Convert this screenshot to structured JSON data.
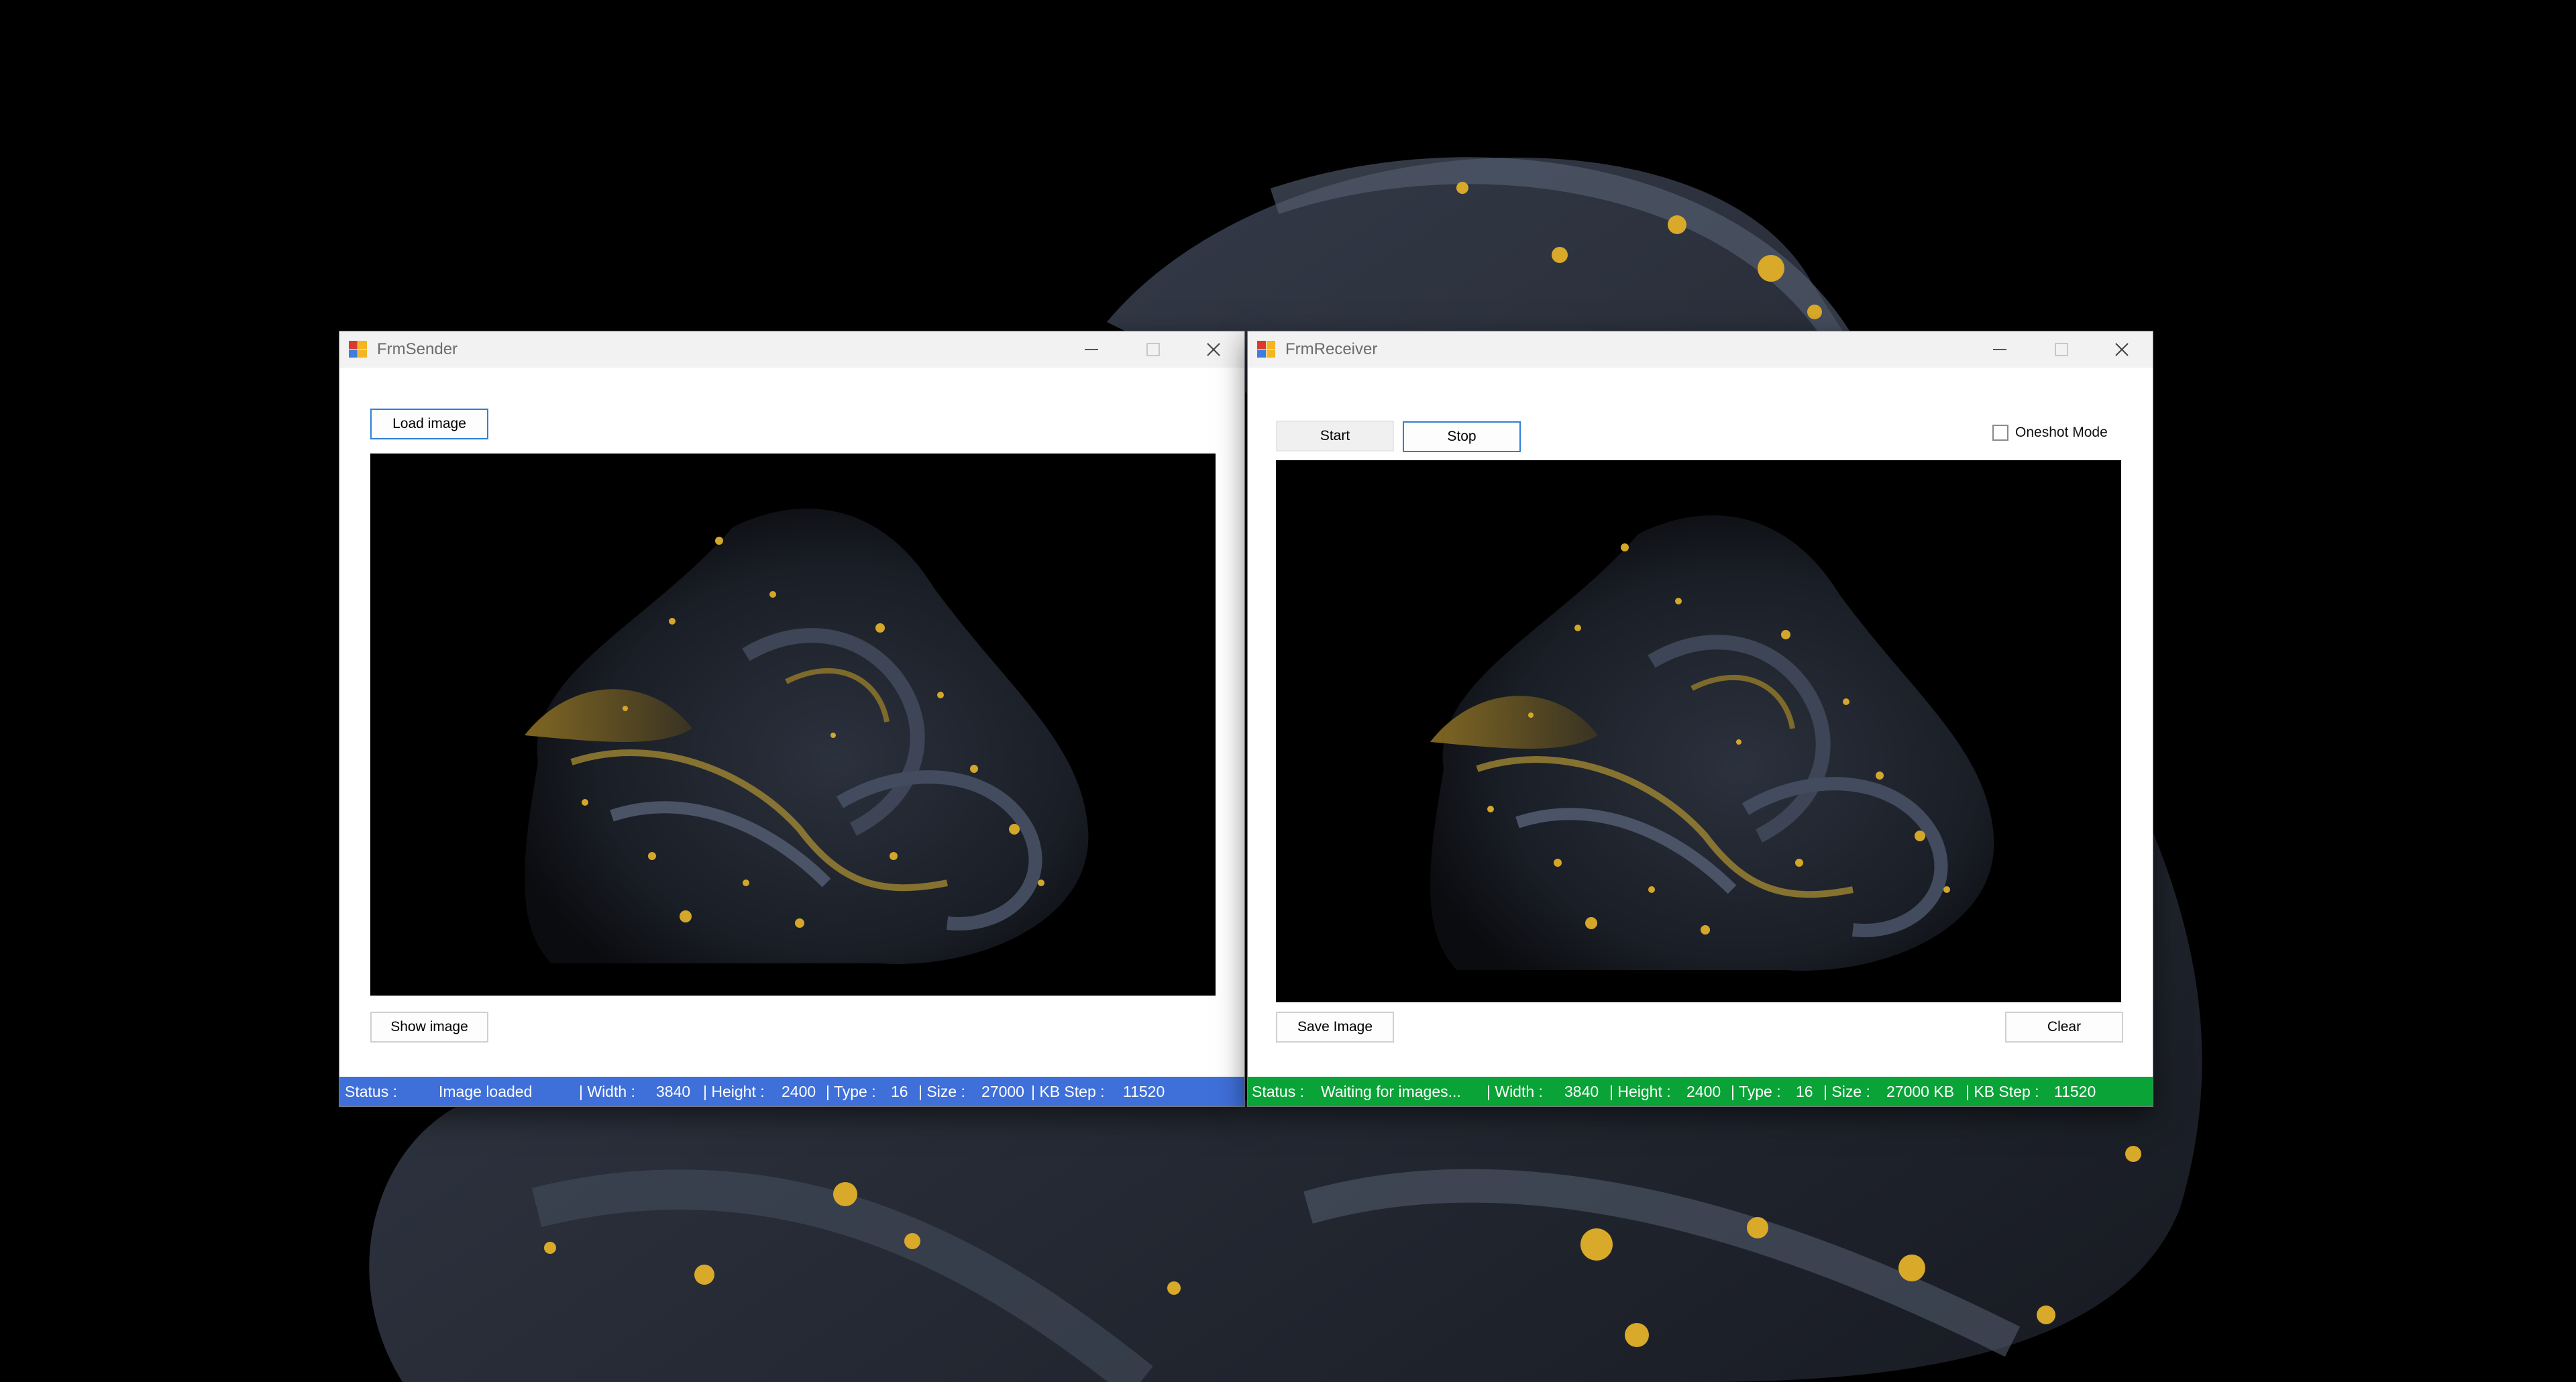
{
  "colors": {
    "sender_status_bg": "#3f6fd9",
    "receiver_status_bg": "#0aa337",
    "focus_border": "#2f7fd8",
    "gold": "#c9a227"
  },
  "sender": {
    "title": "FrmSender",
    "app_icon": "windows-forms-icon",
    "buttons": {
      "load": "Load image",
      "show": "Show image"
    },
    "status": {
      "label": "Status :",
      "text": "Image loaded",
      "width_label": "| Width :",
      "width": "3840",
      "height_label": "| Height :",
      "height": "2400",
      "type_label": "| Type :",
      "type": "16",
      "size_label": "| Size :",
      "size": "27000",
      "kbstep_label": "| KB Step :",
      "kbstep": "11520"
    }
  },
  "receiver": {
    "title": "FrmReceiver",
    "app_icon": "windows-forms-icon",
    "buttons": {
      "start": "Start",
      "stop": "Stop",
      "save": "Save Image",
      "clear": "Clear"
    },
    "oneshot_label": "Oneshot Mode",
    "oneshot_checked": false,
    "status": {
      "label": "Status :",
      "text": "Waiting for images...",
      "width_label": "| Width :",
      "width": "3840",
      "height_label": "| Height :",
      "height": "2400",
      "type_label": "| Type :",
      "type": "16",
      "size_label": "| Size :",
      "size": "27000 KB",
      "kbstep_label": "| KB Step :",
      "kbstep": "11520"
    }
  }
}
